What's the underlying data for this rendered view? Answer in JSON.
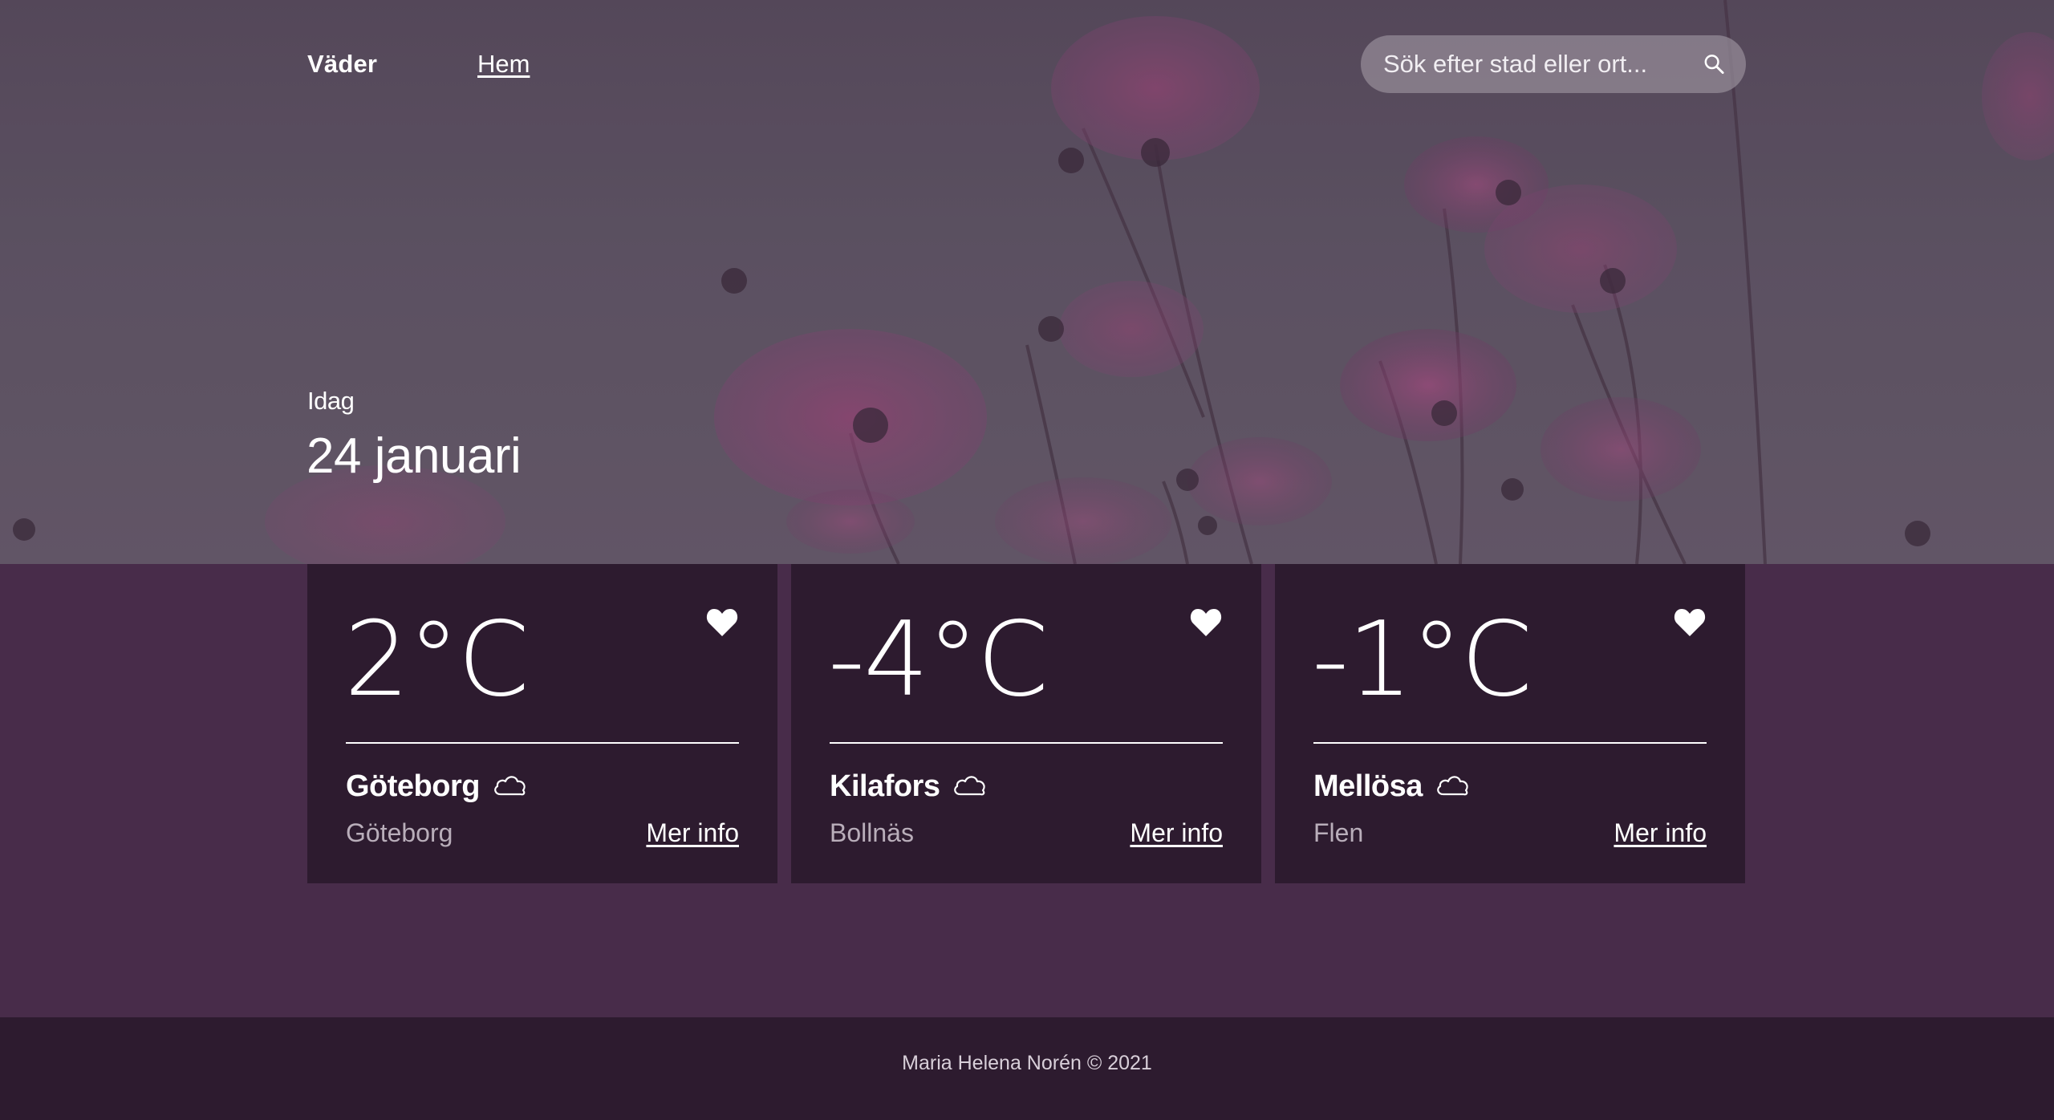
{
  "nav": {
    "brand": "Väder",
    "home_link": "Hem"
  },
  "search": {
    "placeholder": "Sök efter stad eller ort..."
  },
  "hero": {
    "date_label": "Idag",
    "date_value": "24 januari"
  },
  "cards": [
    {
      "temperature": "2°C",
      "city": "Göteborg",
      "region": "Göteborg",
      "more_label": "Mer info",
      "icon": "cloud-icon"
    },
    {
      "temperature": "-4°C",
      "city": "Kilafors",
      "region": "Bollnäs",
      "more_label": "Mer info",
      "icon": "cloud-icon"
    },
    {
      "temperature": "-1°C",
      "city": "Mellösa",
      "region": "Flen",
      "more_label": "Mer info",
      "icon": "cloud-icon"
    }
  ],
  "footer": {
    "text": "Maria Helena Norén © 2021"
  },
  "colors": {
    "content_bg": "#482c4a",
    "card_bg": "#2d1b2f",
    "footer_bg": "#2d1b2f"
  }
}
